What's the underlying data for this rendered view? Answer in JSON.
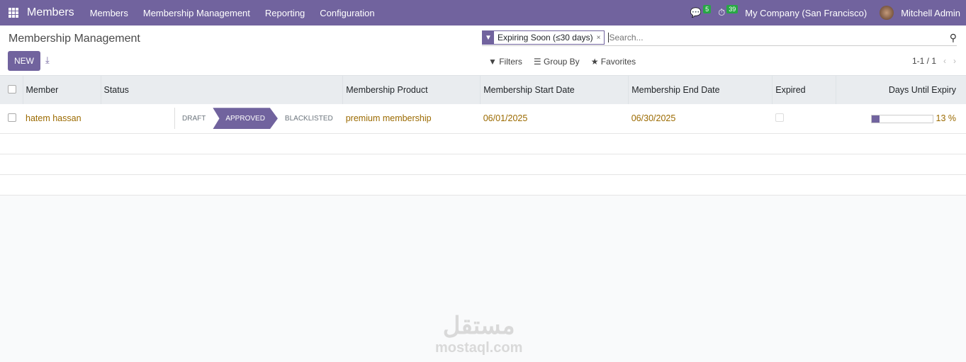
{
  "nav": {
    "app": "Members",
    "menus": [
      "Members",
      "Membership Management",
      "Reporting",
      "Configuration"
    ],
    "messages": "5",
    "activities": "39",
    "company": "My Company (San Francisco)",
    "user": "Mitchell Admin"
  },
  "control": {
    "title": "Membership Management",
    "new_label": "NEW",
    "facet": "Expiring Soon (≤30 days)",
    "search_placeholder": "Search...",
    "filters": "Filters",
    "group_by": "Group By",
    "favorites": "Favorites",
    "pager": "1-1 / 1"
  },
  "table": {
    "headers": [
      "Member",
      "Status",
      "Membership Product",
      "Membership Start Date",
      "Membership End Date",
      "Expired",
      "Days Until Expiry"
    ],
    "rows": [
      {
        "member": "hatem hassan",
        "stages": [
          "DRAFT",
          "APPROVED",
          "BLACKLISTED"
        ],
        "active_stage": "APPROVED",
        "product": "premium membership",
        "start": "06/01/2025",
        "end": "06/30/2025",
        "expired": false,
        "progress": 13,
        "progress_label": "13 %"
      }
    ]
  },
  "accent": "#71639e",
  "watermark": {
    "arabic": "مستقل",
    "latin": "mostaql.com"
  }
}
